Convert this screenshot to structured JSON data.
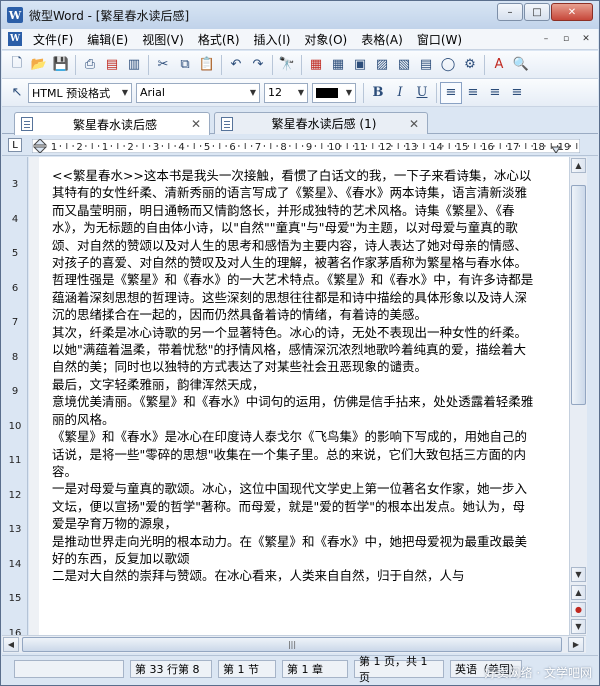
{
  "window": {
    "title": "微型Word - [繁星春水读后感]",
    "app_icon": "W",
    "minimize": "–",
    "maximize": "□",
    "close": "✕"
  },
  "menu": {
    "items": [
      "文件(F)",
      "编辑(E)",
      "视图(V)",
      "格式(R)",
      "插入(I)",
      "对象(O)",
      "表格(A)",
      "窗口(W)"
    ],
    "mdi_minimize": "–",
    "mdi_restore": "▫",
    "mdi_close": "✕"
  },
  "toolbar1": {
    "icons": [
      "new-doc-icon",
      "open-folder-icon",
      "save-icon",
      "print-icon",
      "print-preview-icon",
      "pdf-icon",
      "cut-icon",
      "copy-icon",
      "paste-icon",
      "undo-icon",
      "redo-icon",
      "find-icon",
      "date-icon",
      "insert-table-icon",
      "page-view-icon",
      "image-icon",
      "chart-icon",
      "table-icon",
      "circle-icon",
      "format-icon",
      "text-color-icon",
      "zoom-icon"
    ]
  },
  "toolbar2": {
    "style_value": "HTML 预设格式",
    "font_value": "Arial",
    "size_value": "12",
    "bold": "B",
    "italic": "I",
    "underline": "U",
    "text_color": "#000000"
  },
  "tabs": [
    {
      "label": "繁星春水读后感",
      "active": true
    },
    {
      "label": "繁星春水读后感 (1)",
      "active": false
    }
  ],
  "ruler": {
    "corner": "L",
    "h_marks": [
      "1",
      "2",
      "1",
      "2",
      "3",
      "4",
      "5",
      "6",
      "7",
      "8",
      "9",
      "10",
      "11",
      "12",
      "13",
      "14",
      "15",
      "16",
      "17",
      "18",
      "19"
    ],
    "v_marks": [
      "3",
      "4",
      "5",
      "6",
      "7",
      "8",
      "9",
      "10",
      "11",
      "12",
      "13",
      "14",
      "15",
      "16"
    ]
  },
  "document": {
    "paragraphs": [
      "<<繁星春水>>这本书是我头一次接触，看惯了白话文的我，一下子来看诗集，冰心以其特有的女性纤柔、清新秀丽的语言写成了《繁星》、《春水》两本诗集，语言清新淡雅而又晶莹明丽，明日通畅而又情韵悠长，并形成独特的艺术风格。诗集《繁星》、《春水》，为无标题的自由体小诗，以\"自然\"\"童真\"与\"母爱\"为主题，以对母爱与童真的歌颂、对自然的赞颂以及对人生的思考和感悟为主要内容，诗人表达了她对母亲的情感、对孩子的喜爱、对自然的赞叹及对人生的理解，被著名作家茅盾称为繁星格与春水体。",
      "  哲理性强是《繁星》和《春水》的一大艺术特点。《繁星》和《春水》中，有许多诗都是蕴涵着深刻思想的哲理诗。这些深刻的思想往往都是和诗中描绘的具体形象以及诗人深沉的思绪揉合在一起的，因而仍然具备着诗的情绪，有着诗的美感。",
      "  其次，纤柔是冰心诗歌的另一个显著特色。冰心的诗，无处不表现出一种女性的纤柔。以她\"满蕴着温柔，带着忧愁\"的抒情风格，感情深沉浓烈地歌吟着纯真的爱，描绘着大自然的美；同时也以独特的方式表达了对某些社会丑恶现象的谴责。",
      "  最后，文字轻柔雅丽，韵律浑然天成，",
      "意境优美清丽。《繁星》和《春水》中词句的运用，仿佛是信手拈来，处处透露着轻柔雅丽的风格。",
      "  《繁星》和《春水》是冰心在印度诗人泰戈尔《飞鸟集》的影响下写成的，用她自己的话说，是将一些\"零碎的思想\"收集在一个集子里。总的来说，它们大致包括三方面的内容。",
      "  一是对母爱与童真的歌颂。冰心，这位中国现代文学史上第一位著名女作家，她一步入文坛，便以宣扬\"爱的哲学\"著称。而母爱，就是\"爱的哲学\"的根本出发点。她认为，母爱是孕育万物的源泉，",
      "是推动世界走向光明的根本动力。在《繁星》和《春水》中，她把母爱视为最重改最美好的东西，反复加以歌颂",
      "  二是对大自然的崇拜与赞颂。在冰心看来，人类来自自然，归于自然，人与"
    ]
  },
  "status": {
    "panels": [
      "",
      "第 33 行第 8",
      "第 1 节",
      "第 1 章",
      "第 1 页，共 1 页",
      "英语（美国）"
    ],
    "watermark": "好卖网络 · 文学吧网"
  }
}
